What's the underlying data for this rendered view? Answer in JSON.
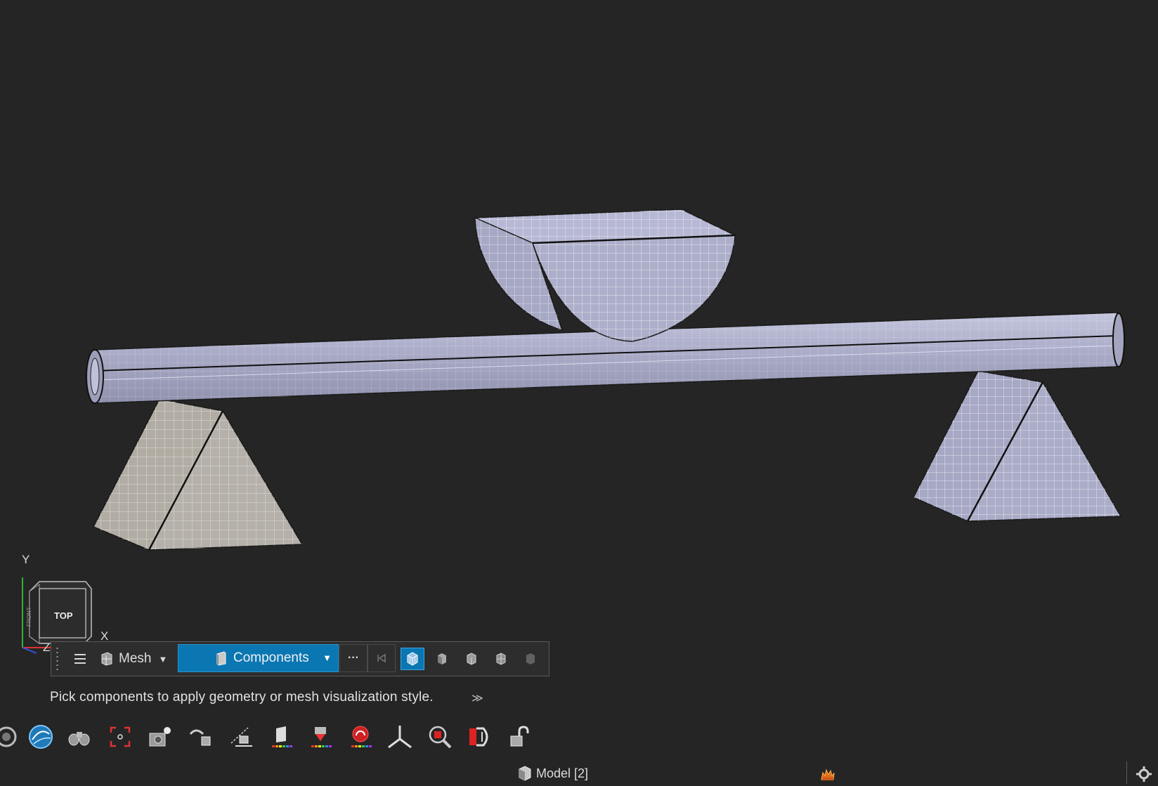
{
  "viewport": {
    "axis_y": "Y",
    "axis_x": "X",
    "axis_z": "Z",
    "view_cube_face": "TOP",
    "view_cube_side_face": "FRONT",
    "colors": {
      "background": "#252525",
      "mesh_fill_blue": "#a8aac7",
      "mesh_fill_gray": "#b3afa7",
      "mesh_lines": "#e9e9f3"
    }
  },
  "guide_bar": {
    "menu_icon": "hamburger-icon",
    "mode_label": "Mesh",
    "selector_label": "Components",
    "more_label": "···",
    "style_buttons": [
      "mesh-wireframe-style-icon",
      "shaded-style-icon",
      "shaded-edges-style-icon",
      "mesh-lines-style-icon",
      "transparent-style-icon"
    ],
    "active_style": "mesh-wireframe-style-icon",
    "accent_color": "#0a77b3"
  },
  "status": {
    "message": "Pick components to apply geometry or mesh visualization style.",
    "expand_glyph": "≫"
  },
  "toolbar": {
    "tools": [
      "rotate-icon",
      "visualization-globe-icon",
      "binoculars-icon",
      "fit-view-icon",
      "camera-icon",
      "isolate-icon",
      "section-cut-icon",
      "contour-icon",
      "deformation-icon",
      "legend-icon",
      "triad-icon",
      "zoom-box-icon",
      "plot-icon",
      "unlock-icon"
    ]
  },
  "bottom_bar": {
    "model_tab": "Model [2]"
  }
}
